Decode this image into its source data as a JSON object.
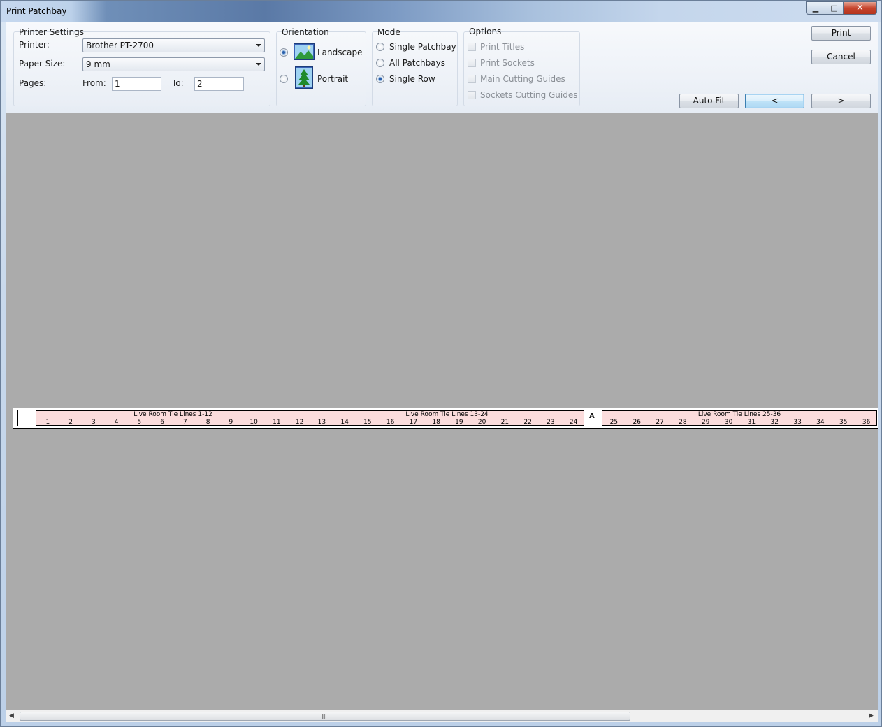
{
  "window": {
    "title": "Print Patchbay",
    "close_glyph": "✕",
    "min_glyph": "▁",
    "max_glyph": "□"
  },
  "printer_settings": {
    "legend": "Printer Settings",
    "printer_label": "Printer:",
    "printer_value": "Brother PT-2700",
    "paper_label": "Paper Size:",
    "paper_value": "9 mm",
    "pages_label": "Pages:",
    "from_label": "From:",
    "from_value": "1",
    "to_label": "To:",
    "to_value": "2"
  },
  "orientation": {
    "legend": "Orientation",
    "options": [
      "Landscape",
      "Portrait"
    ],
    "selected": "Landscape"
  },
  "mode": {
    "legend": "Mode",
    "options": [
      "Single Patchbay",
      "All Patchbays",
      "Single Row"
    ],
    "selected": "Single Row"
  },
  "options": {
    "legend": "Options",
    "items": [
      "Print Titles",
      "Print Sockets",
      "Main Cutting Guides",
      "Sockets Cutting Guides"
    ]
  },
  "buttons": {
    "print": "Print",
    "cancel": "Cancel",
    "auto_fit": "Auto Fit",
    "prev": "<",
    "next": ">"
  },
  "preview": {
    "background": "#ababab",
    "section_color": "#fbdcdc",
    "sections": [
      {
        "title": "Live Room Tie Lines 1-12",
        "numbers": [
          "1",
          "2",
          "3",
          "4",
          "5",
          "6",
          "7",
          "8",
          "9",
          "10",
          "11",
          "12"
        ]
      },
      {
        "title": "Live Room Tie Lines 13-24",
        "numbers": [
          "13",
          "14",
          "15",
          "16",
          "17",
          "18",
          "19",
          "20",
          "21",
          "22",
          "23",
          "24"
        ]
      },
      {
        "title": "Live Room Tie Lines 25-36",
        "numbers": [
          "25",
          "26",
          "27",
          "28",
          "29",
          "30",
          "31",
          "32",
          "33",
          "34",
          "35",
          "36"
        ]
      }
    ],
    "divider_label": "A"
  },
  "scrollbar": {
    "left_arrow": "◀",
    "right_arrow": "▶",
    "grip": "|||"
  },
  "icons": {
    "landscape": "landscape-picture-icon",
    "portrait": "tree-picture-icon"
  }
}
